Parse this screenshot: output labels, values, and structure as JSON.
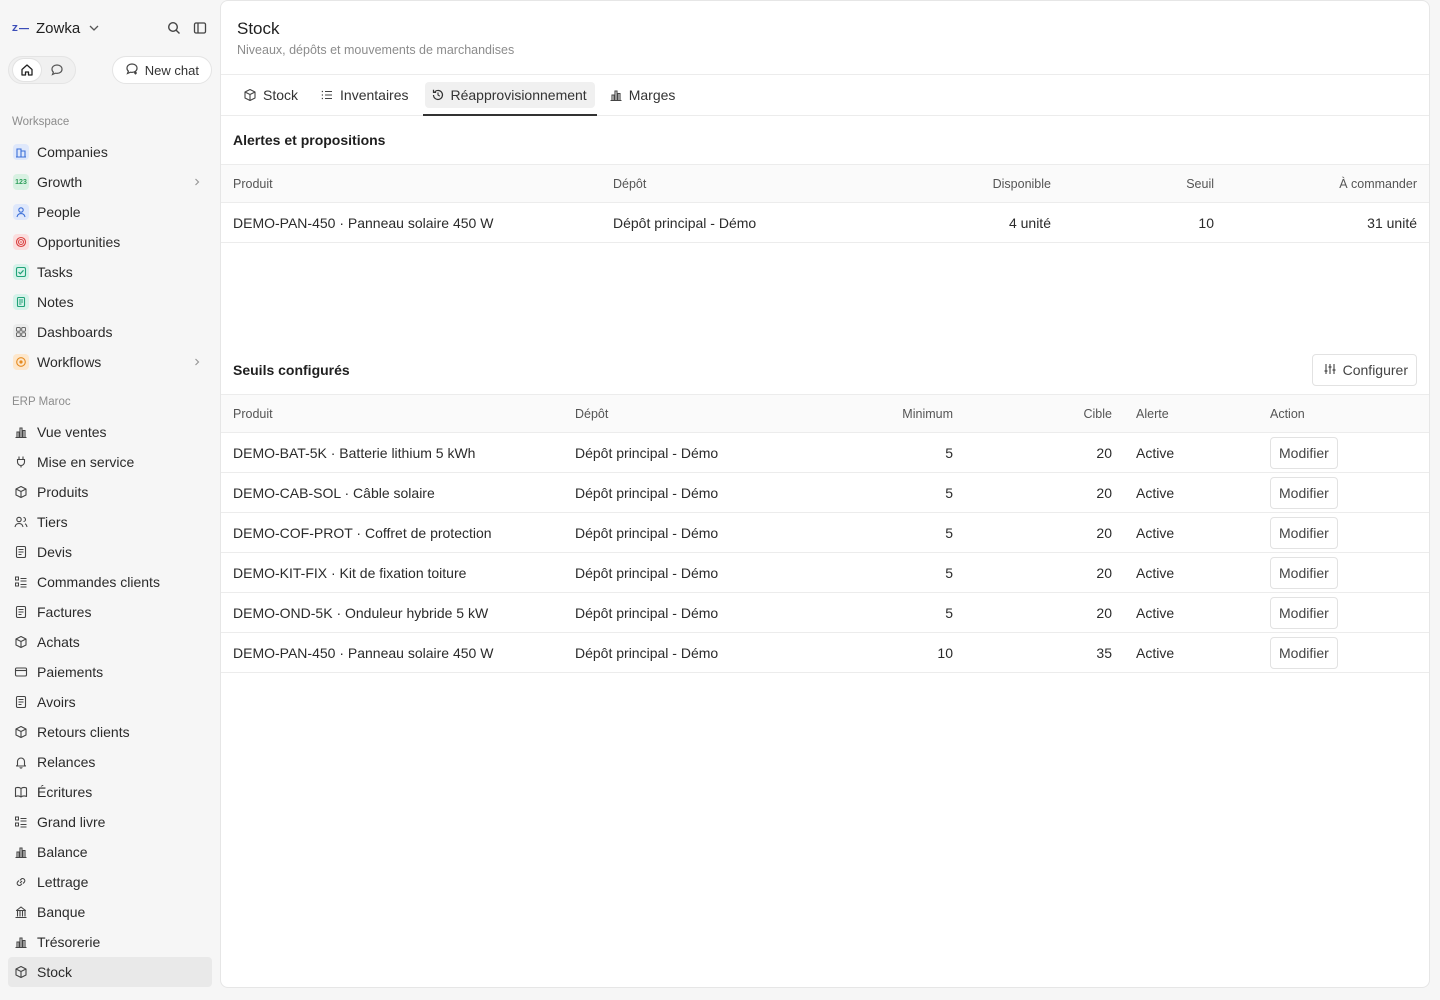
{
  "workspace": {
    "name": "Zowka",
    "logo_text": "Z"
  },
  "quick": {
    "new_chat_label": "New chat"
  },
  "sidebar": {
    "workspace_label": "Workspace",
    "workspace_items": [
      {
        "label": "Companies",
        "icon": "building-icon",
        "color": "#3b6fd8"
      },
      {
        "label": "Growth",
        "icon": "growth-icon",
        "color": "#2e9e5b"
      },
      {
        "label": "People",
        "icon": "person-icon",
        "color": "#3b6fd8"
      },
      {
        "label": "Opportunities",
        "icon": "target-icon",
        "color": "#d94242"
      },
      {
        "label": "Tasks",
        "icon": "checkbox-icon",
        "color": "#21a378"
      },
      {
        "label": "Notes",
        "icon": "note-icon",
        "color": "#21a378"
      },
      {
        "label": "Dashboards",
        "icon": "dashboard-icon",
        "color": "#777777"
      },
      {
        "label": "Workflows",
        "icon": "workflow-icon",
        "color": "#e58a1f"
      }
    ],
    "erp_label": "ERP Maroc",
    "erp_items": [
      {
        "label": "Vue ventes",
        "icon": "chart-icon"
      },
      {
        "label": "Mise en service",
        "icon": "plug-icon"
      },
      {
        "label": "Produits",
        "icon": "box-icon"
      },
      {
        "label": "Tiers",
        "icon": "users-icon"
      },
      {
        "label": "Devis",
        "icon": "document-icon"
      },
      {
        "label": "Commandes clients",
        "icon": "list-icon"
      },
      {
        "label": "Factures",
        "icon": "document-icon"
      },
      {
        "label": "Achats",
        "icon": "box-icon"
      },
      {
        "label": "Paiements",
        "icon": "card-icon"
      },
      {
        "label": "Avoirs",
        "icon": "document-icon"
      },
      {
        "label": "Retours clients",
        "icon": "box-icon"
      },
      {
        "label": "Relances",
        "icon": "bell-icon"
      },
      {
        "label": "Écritures",
        "icon": "book-icon"
      },
      {
        "label": "Grand livre",
        "icon": "list-icon"
      },
      {
        "label": "Balance",
        "icon": "chart-icon"
      },
      {
        "label": "Lettrage",
        "icon": "link-icon"
      },
      {
        "label": "Banque",
        "icon": "bank-icon"
      },
      {
        "label": "Trésorerie",
        "icon": "chart-icon"
      },
      {
        "label": "Stock",
        "icon": "box-icon",
        "active": true
      }
    ]
  },
  "page": {
    "title": "Stock",
    "subtitle": "Niveaux, dépôts et mouvements de marchandises"
  },
  "tabs": [
    {
      "label": "Stock",
      "icon": "box-icon"
    },
    {
      "label": "Inventaires",
      "icon": "list-icon"
    },
    {
      "label": "Réapprovisionnement",
      "icon": "refresh-icon",
      "active": true
    },
    {
      "label": "Marges",
      "icon": "chart-icon"
    }
  ],
  "alerts": {
    "title": "Alertes et propositions",
    "columns": {
      "produit": "Produit",
      "depot": "Dépôt",
      "disponible": "Disponible",
      "seuil": "Seuil",
      "commander": "À commander"
    },
    "rows": [
      {
        "produit": "DEMO-PAN-450 · Panneau solaire 450 W",
        "depot": "Dépôt principal - Démo",
        "disponible": "4 unité",
        "seuil": "10",
        "commander": "31 unité"
      }
    ]
  },
  "thresholds": {
    "title": "Seuils configurés",
    "configure_label": "Configurer",
    "columns": {
      "produit": "Produit",
      "depot": "Dépôt",
      "minimum": "Minimum",
      "cible": "Cible",
      "alerte": "Alerte",
      "action": "Action"
    },
    "action_label": "Modifier",
    "rows": [
      {
        "produit": "DEMO-BAT-5K · Batterie lithium 5 kWh",
        "depot": "Dépôt principal - Démo",
        "minimum": "5",
        "cible": "20",
        "alerte": "Active"
      },
      {
        "produit": "DEMO-CAB-SOL · Câble solaire",
        "depot": "Dépôt principal - Démo",
        "minimum": "5",
        "cible": "20",
        "alerte": "Active"
      },
      {
        "produit": "DEMO-COF-PROT · Coffret de protection",
        "depot": "Dépôt principal - Démo",
        "minimum": "5",
        "cible": "20",
        "alerte": "Active"
      },
      {
        "produit": "DEMO-KIT-FIX · Kit de fixation toiture",
        "depot": "Dépôt principal - Démo",
        "minimum": "5",
        "cible": "20",
        "alerte": "Active"
      },
      {
        "produit": "DEMO-OND-5K · Onduleur hybride 5 kW",
        "depot": "Dépôt principal - Démo",
        "minimum": "5",
        "cible": "20",
        "alerte": "Active"
      },
      {
        "produit": "DEMO-PAN-450 · Panneau solaire 450 W",
        "depot": "Dépôt principal - Démo",
        "minimum": "10",
        "cible": "35",
        "alerte": "Active"
      }
    ]
  }
}
